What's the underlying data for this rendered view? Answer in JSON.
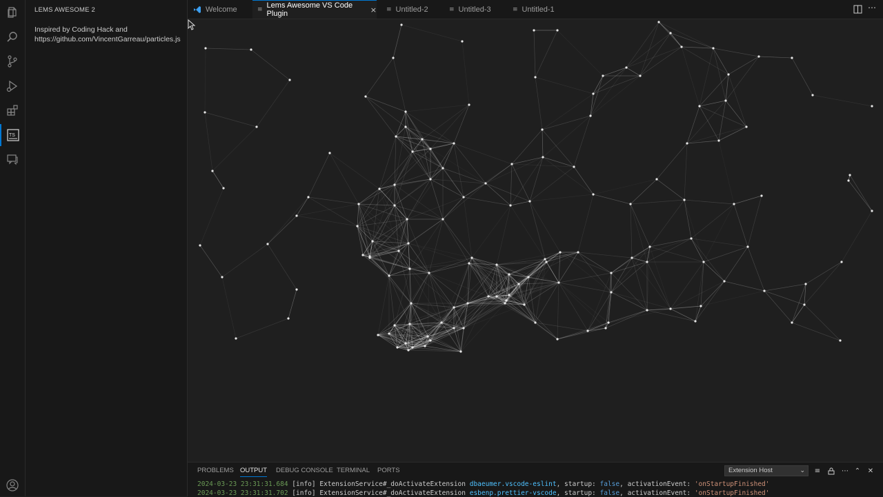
{
  "sidebar": {
    "title": "LEMS AWESOME 2",
    "line1": "Inspired by Coding Hack and",
    "line2": "https://github.com/VincentGarreau/particles.js"
  },
  "tabs": [
    {
      "label": "Welcome",
      "icon": "vscode-icon"
    },
    {
      "label": "Lems Awesome VS Code Plugin",
      "icon": "file-icon",
      "active": true
    },
    {
      "label": "Untitled-2",
      "icon": "file-icon"
    },
    {
      "label": "Untitled-3",
      "icon": "file-icon"
    },
    {
      "label": "Untitled-1",
      "icon": "file-icon"
    }
  ],
  "tab_close": "×",
  "panel": {
    "tabs": [
      "PROBLEMS",
      "OUTPUT",
      "DEBUG CONSOLE",
      "TERMINAL",
      "PORTS"
    ],
    "active_tab": "OUTPUT",
    "channel": "Extension Host",
    "logs": [
      {
        "ts": "2024-03-23 23:31:31.684",
        "level": "[info]",
        "msg": "ExtensionService#_doActivateExtension",
        "ext": "dbaeumer.vscode-eslint",
        "startup": "startup:",
        "bool": "false",
        "event": ", activationEvent:",
        "value": "'onStartupFinished'"
      },
      {
        "ts": "2024-03-23 23:31:31.702",
        "level": "[info]",
        "msg": "ExtensionService#_doActivateExtension",
        "ext": "esbenp.prettier-vscode",
        "startup": "startup:",
        "bool": "false",
        "event": ", activationEvent:",
        "value": "'onStartupFinished'"
      }
    ]
  },
  "colors": {
    "accent": "#0078d4",
    "background": "#1f1f1f",
    "sidebar": "#181818",
    "particle": "#ffffff"
  }
}
